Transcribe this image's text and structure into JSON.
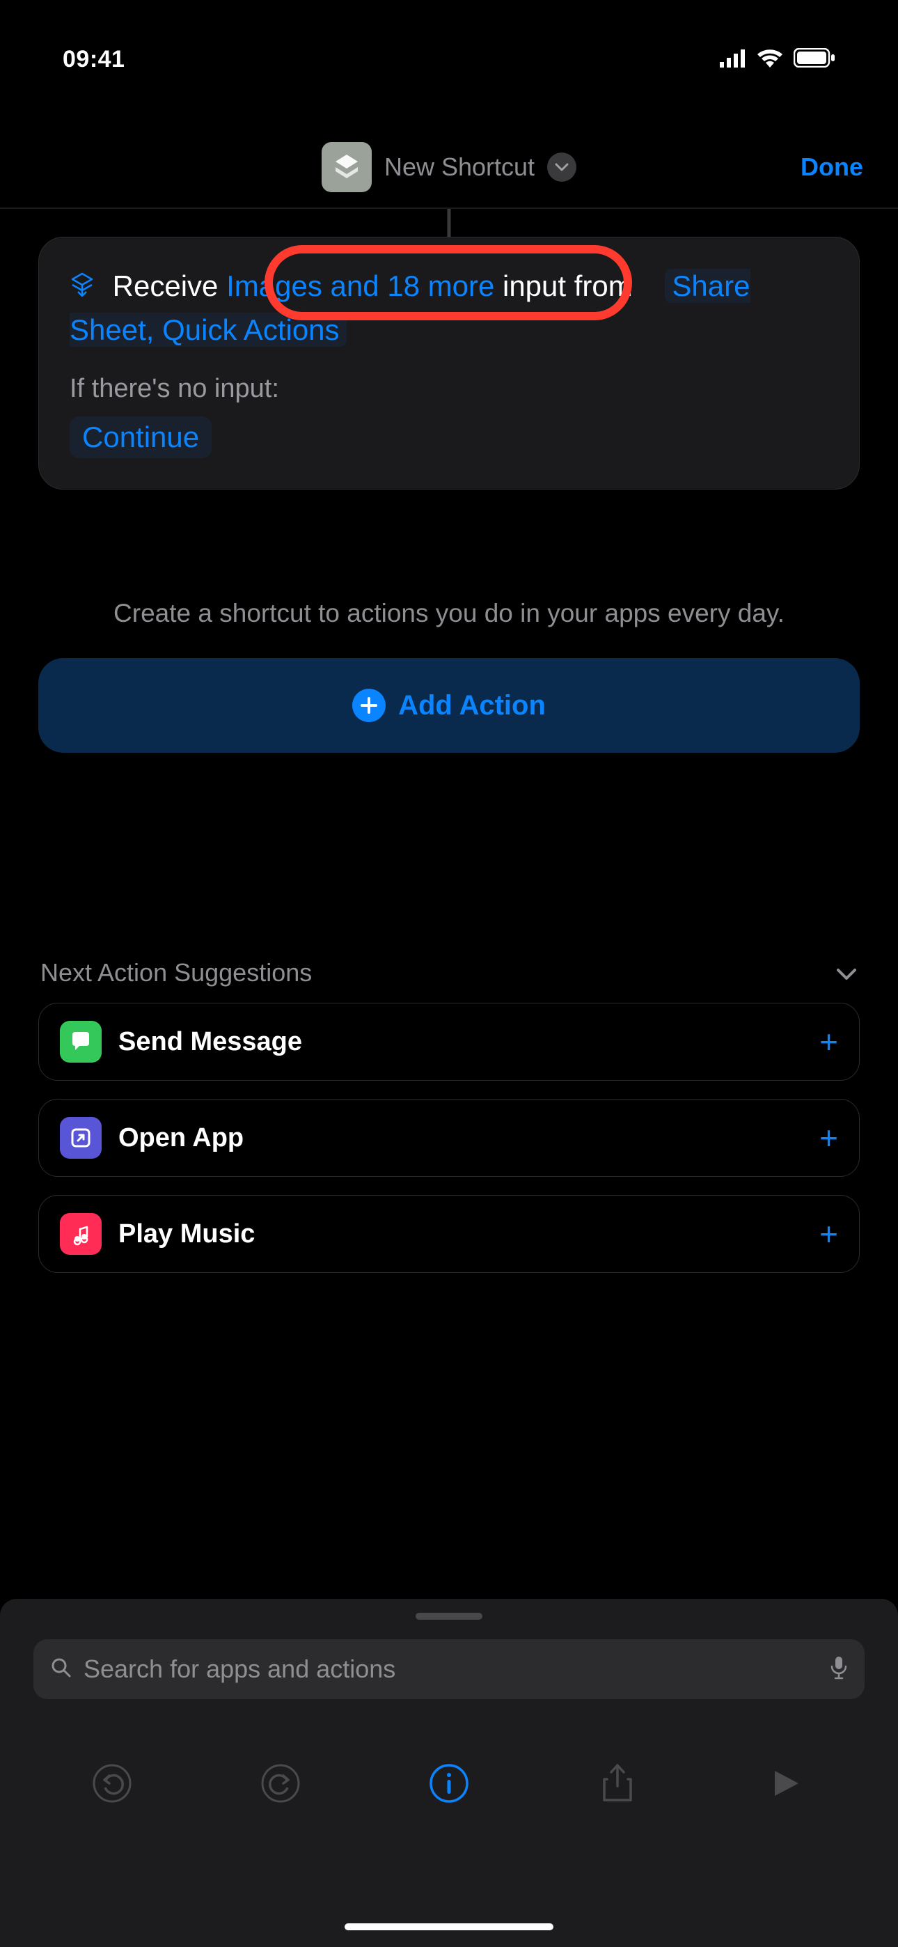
{
  "status": {
    "time": "09:41"
  },
  "nav": {
    "title": "New Shortcut",
    "done": "Done"
  },
  "input_card": {
    "receive_label": "Receive",
    "types_token": "Images and 18 more",
    "input_label": "input",
    "from_label": "from",
    "source_token": "Share Sheet, Quick Actions",
    "no_input_label": "If there's no input:",
    "fallback_token": "Continue"
  },
  "helper": "Create a shortcut to actions you do in your apps every day.",
  "add_action": "Add Action",
  "suggestions": {
    "header": "Next Action Suggestions",
    "items": [
      {
        "label": "Send Message",
        "icon_bg": "#34c759"
      },
      {
        "label": "Open App",
        "icon_bg": "#5856d6"
      },
      {
        "label": "Play Music",
        "icon_bg": "#ff2d55"
      }
    ]
  },
  "search": {
    "placeholder": "Search for apps and actions"
  }
}
